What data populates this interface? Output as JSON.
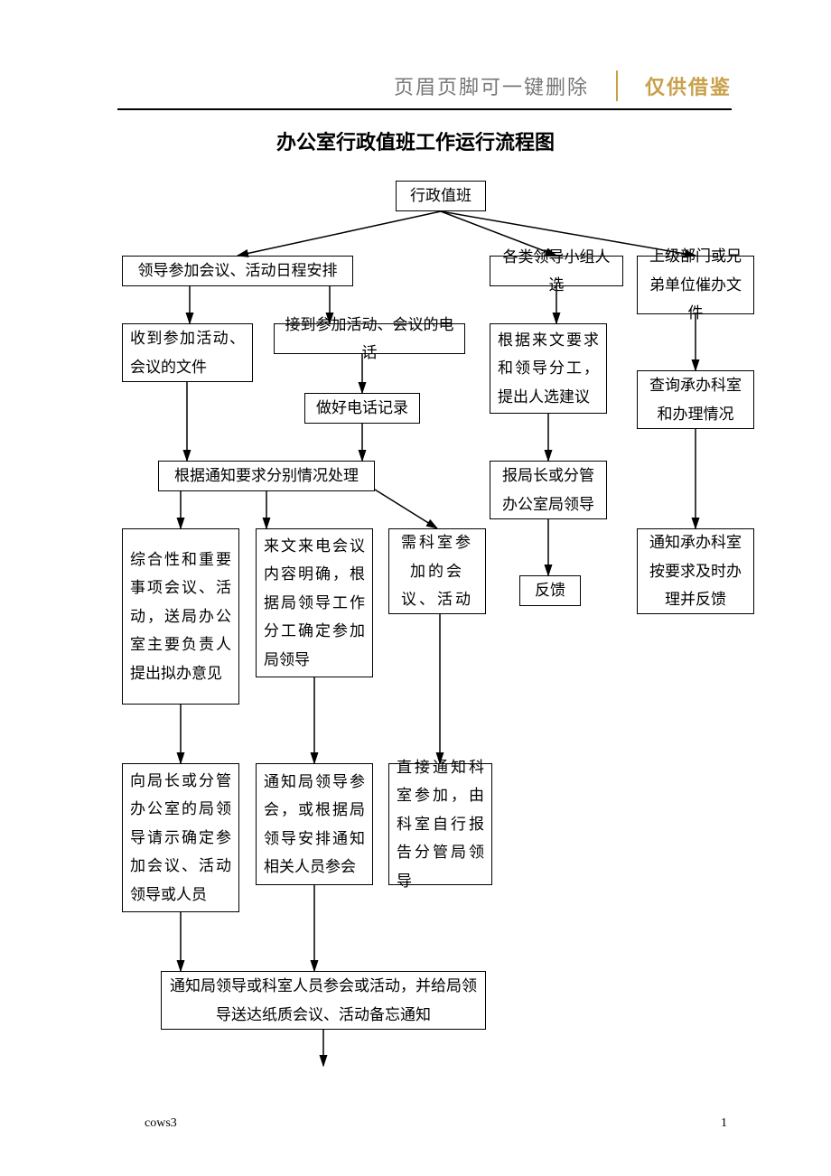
{
  "header": {
    "main": "页眉页脚可一键删除",
    "side": "仅供借鉴"
  },
  "title": "办公室行政值班工作运行流程图",
  "nodes": {
    "root": "行政值班",
    "b1": "领导参加会议、活动日程安排",
    "b2": "各类领导小组人选",
    "b3": "上级部门或兄弟单位催办文件",
    "c1": "收到参加活动、会议的文件",
    "c2": "接到参加活动、会议的电话",
    "c3": "根据来文要求和领导分工，提出人选建议",
    "c4": "查询承办科室和办理情况",
    "d1": "做好电话记录",
    "e1": "根据通知要求分别情况处理",
    "e2": "报局长或分管办公室局领导",
    "e3": "通知承办科室按要求及时办理并反馈",
    "f1": "综合性和重要事项会议、活动，送局办公室主要负责人提出拟办意见",
    "f2": "来文来电会议内容明确，根据局领导工作分工确定参加局领导",
    "f3": "需科室参加的会议、活动",
    "f4": "反馈",
    "g1": "向局长或分管办公室的局领导请示确定参加会议、活动领导或人员",
    "g2": "通知局领导参会，或根据局领导安排通知相关人员参会",
    "g3": "直接通知科室参加，由科室自行报告分管局领导",
    "h1": "通知局领导或科室人员参会或活动，并给局领导送达纸质会议、活动备忘通知"
  },
  "footer": {
    "left": "cows3",
    "right": "1"
  }
}
